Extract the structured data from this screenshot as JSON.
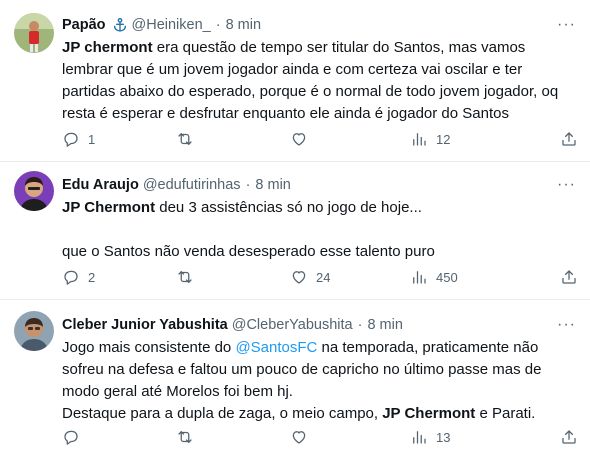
{
  "tweets": [
    {
      "name": "Papão",
      "handle": "@Heiniken_",
      "time": "8 min",
      "badge_icon": "anchor-icon",
      "paragraphs": [
        [
          {
            "text": "JP chermont",
            "bold": true
          },
          {
            "text": " era questão de tempo ser titular do Santos, mas vamos lembrar que é um jovem jogador ainda e com certeza vai oscilar e ter partidas abaixo do esperado, porque é o normal de todo jovem jogador, oq resta é esperar e desfrutar enquanto ele ainda é jogador do Santos"
          }
        ]
      ],
      "replies": "1",
      "retweets": "",
      "likes": "",
      "views": "12"
    },
    {
      "name": "Edu Araujo",
      "handle": "@edufutirinhas",
      "time": "8 min",
      "paragraphs": [
        [
          {
            "text": "JP Chermont",
            "bold": true
          },
          {
            "text": " deu 3 assistências só no jogo de hoje..."
          }
        ],
        [],
        [
          {
            "text": "que o Santos não venda desesperado esse talento puro"
          }
        ]
      ],
      "replies": "2",
      "retweets": "",
      "likes": "24",
      "views": "450"
    },
    {
      "name": "Cleber Junior Yabushita",
      "handle": "@CleberYabushita",
      "time": "8 min",
      "paragraphs": [
        [
          {
            "text": "Jogo mais consistente do "
          },
          {
            "text": "@SantosFC",
            "mention": true
          },
          {
            "text": " na temporada, praticamente não sofreu na defesa e faltou um pouco de capricho no último passe mas de modo geral até Morelos foi bem hj."
          }
        ],
        [
          {
            "text": "Destaque para a dupla de zaga,  o meio campo, "
          },
          {
            "text": "JP Chermont",
            "bold": true
          },
          {
            "text": " e Parati."
          }
        ]
      ],
      "replies": "",
      "retweets": "",
      "likes": "",
      "views": "13"
    }
  ],
  "more_label": "···",
  "colors": {
    "text": "#0f1419",
    "muted": "#536471",
    "link": "#1d9bf0",
    "divider": "#e6ecf0"
  }
}
